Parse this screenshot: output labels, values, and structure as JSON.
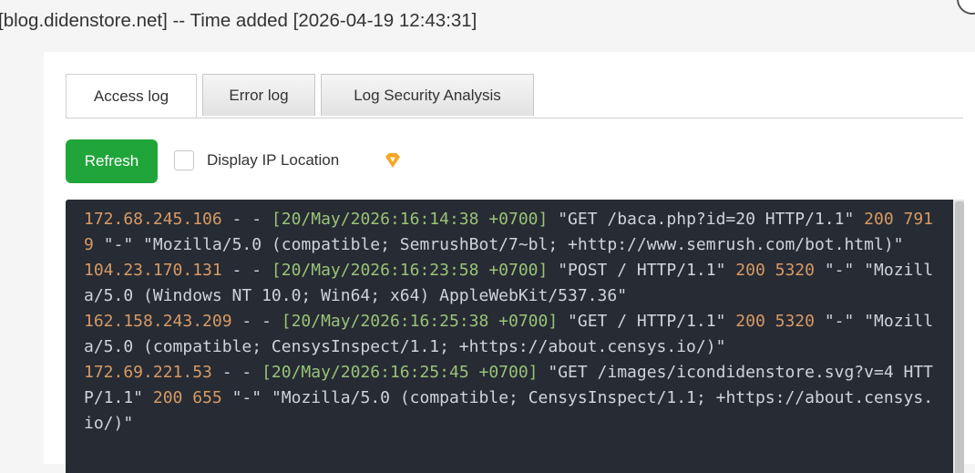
{
  "window": {
    "title": "[blog.didenstore.net] -- Time added [2026-04-19 12:43:31]"
  },
  "tabs": [
    {
      "label": "Access log",
      "active": true
    },
    {
      "label": "Error log",
      "active": false
    },
    {
      "label": "Log Security Analysis",
      "active": false
    }
  ],
  "toolbar": {
    "refresh_label": "Refresh",
    "display_ip_label": "Display IP Location",
    "display_ip_checked": false,
    "vip_icon": "diamond-icon"
  },
  "log": {
    "entries": [
      {
        "ip": "172.68.245.106",
        "date": "[20/May/2026:16:14:38 +0700]",
        "request": "\"GET /baca.php?id=20 HTTP/1.1\"",
        "status": "200",
        "size": "7919",
        "referer": "\"-\"",
        "agent": "\"Mozilla/5.0 (compatible; SemrushBot/7~bl; +http://www.semrush.com/bot.html)\""
      },
      {
        "ip": "104.23.170.131",
        "date": "[20/May/2026:16:23:58 +0700]",
        "request": "\"POST / HTTP/1.1\"",
        "status": "200",
        "size": "5320",
        "referer": "\"-\"",
        "agent": "\"Mozilla/5.0 (Windows NT 10.0; Win64; x64) AppleWebKit/537.36\""
      },
      {
        "ip": "162.158.243.209",
        "date": "[20/May/2026:16:25:38 +0700]",
        "request": "\"GET / HTTP/1.1\"",
        "status": "200",
        "size": "5320",
        "referer": "\"-\"",
        "agent": "\"Mozilla/5.0 (compatible; CensysInspect/1.1; +https://about.censys.io/)\""
      },
      {
        "ip": "172.69.221.53",
        "date": "[20/May/2026:16:25:45 +0700]",
        "request": "\"GET /images/icondidenstore.svg?v=4 HTTP/1.1\"",
        "status": "200",
        "size": "655",
        "referer": "\"-\"",
        "agent": "\"Mozilla/5.0 (compatible; CensysInspect/1.1; +https://about.censys.io/)\""
      }
    ]
  },
  "colors": {
    "accent": "#20a53a",
    "log_bg": "#272b33",
    "log_ip": "#d69a66",
    "log_date": "#98c379",
    "log_text": "#cfd3da",
    "vip": "#f5a623"
  }
}
